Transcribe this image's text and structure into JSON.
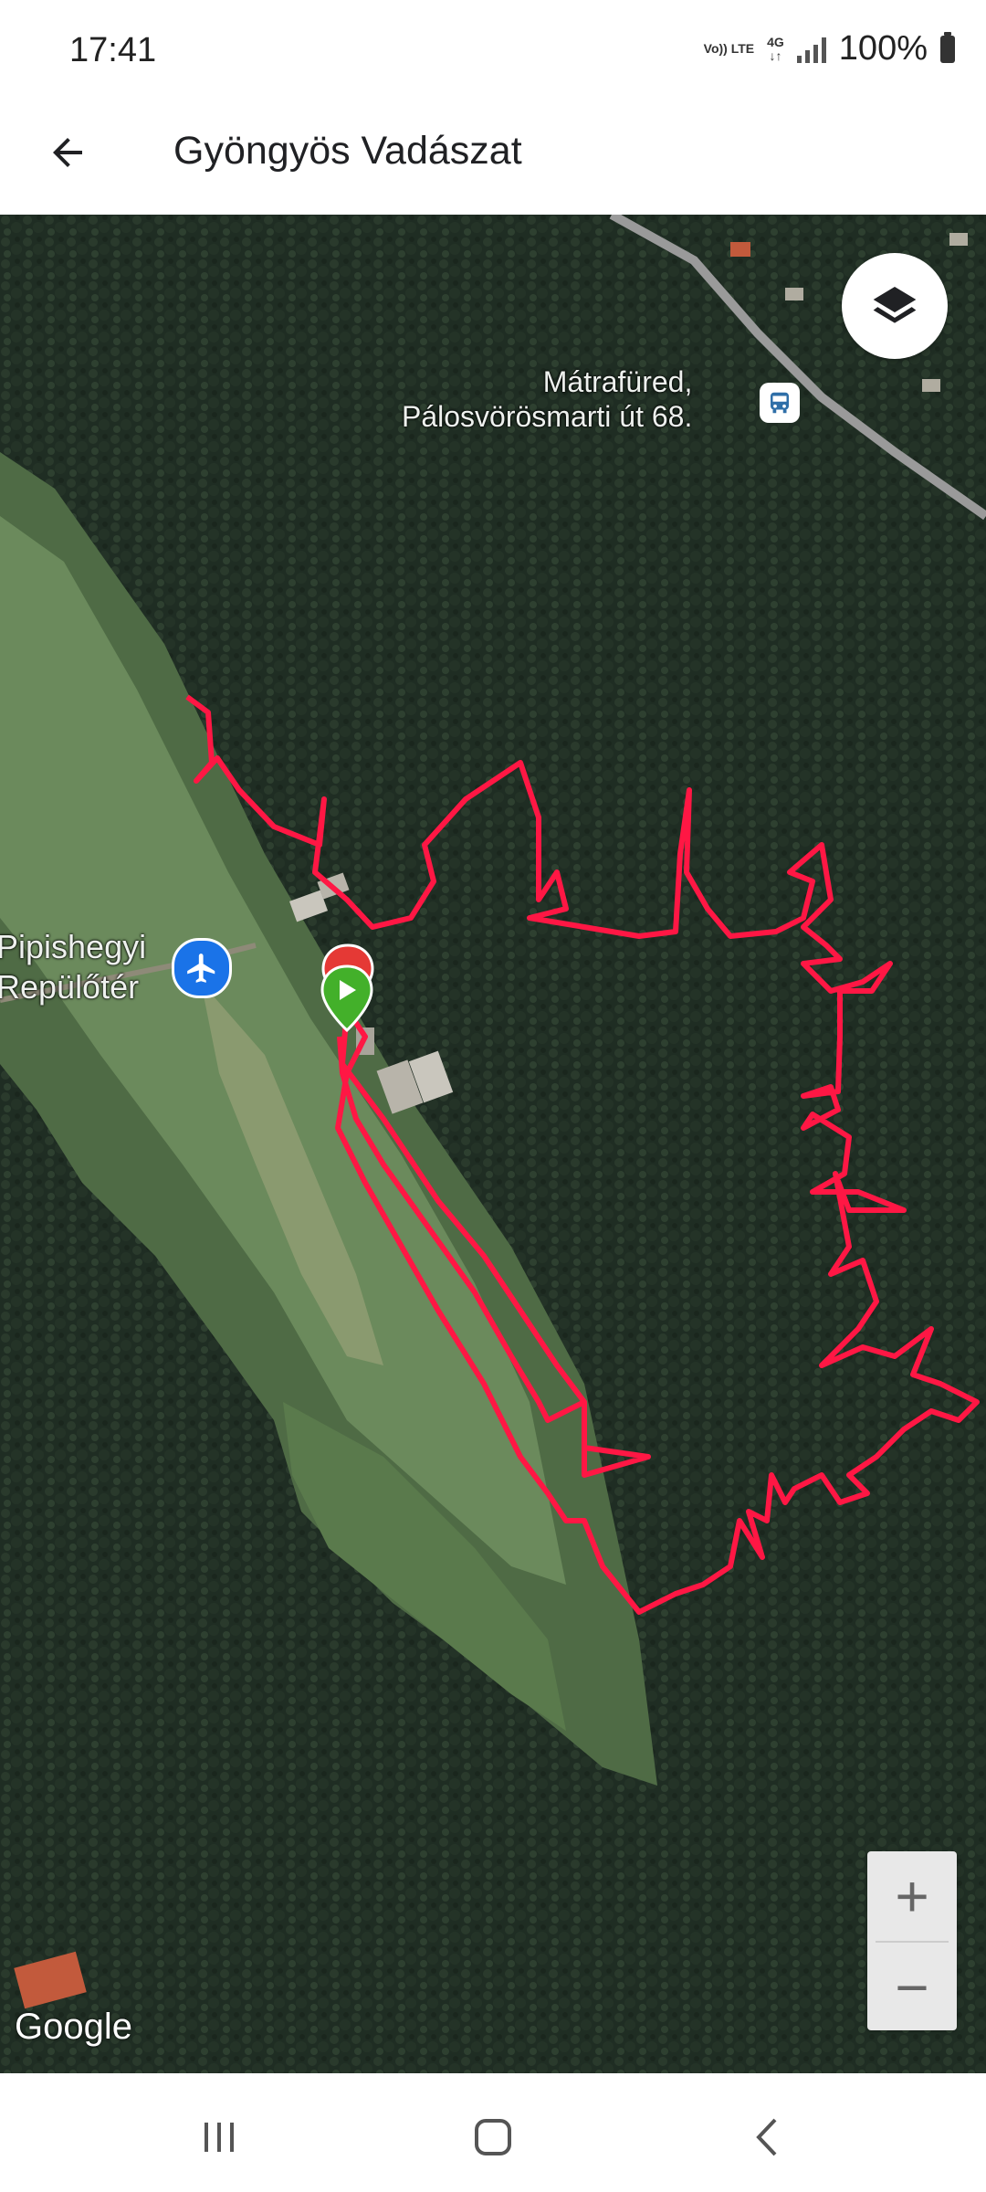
{
  "status_bar": {
    "time": "17:41",
    "network_1": "Vo)) LTE",
    "network_2": "4G",
    "battery": "100%"
  },
  "app_bar": {
    "title": "Gyöngyös Vadászat",
    "back_icon": "arrow-left-icon"
  },
  "map": {
    "layers_icon": "layers-icon",
    "place_1_line_1": "Mátrafüred,",
    "place_1_line_2": "Pálosvörösmarti út 68.",
    "place_1_icon": "bus-icon",
    "place_2_line_1": "Pipishegyi",
    "place_2_line_2": "Repülőtér",
    "place_2_icon": "airport-icon",
    "attribution": "Google",
    "zoom_in": "+",
    "zoom_out": "−",
    "track_color": "#ff1744",
    "start_marker_color": "#43b02a",
    "end_marker_color": "#e53935"
  },
  "nav_bar": {
    "recents_icon": "recents-icon",
    "home_icon": "home-icon",
    "back_icon": "back-icon"
  }
}
